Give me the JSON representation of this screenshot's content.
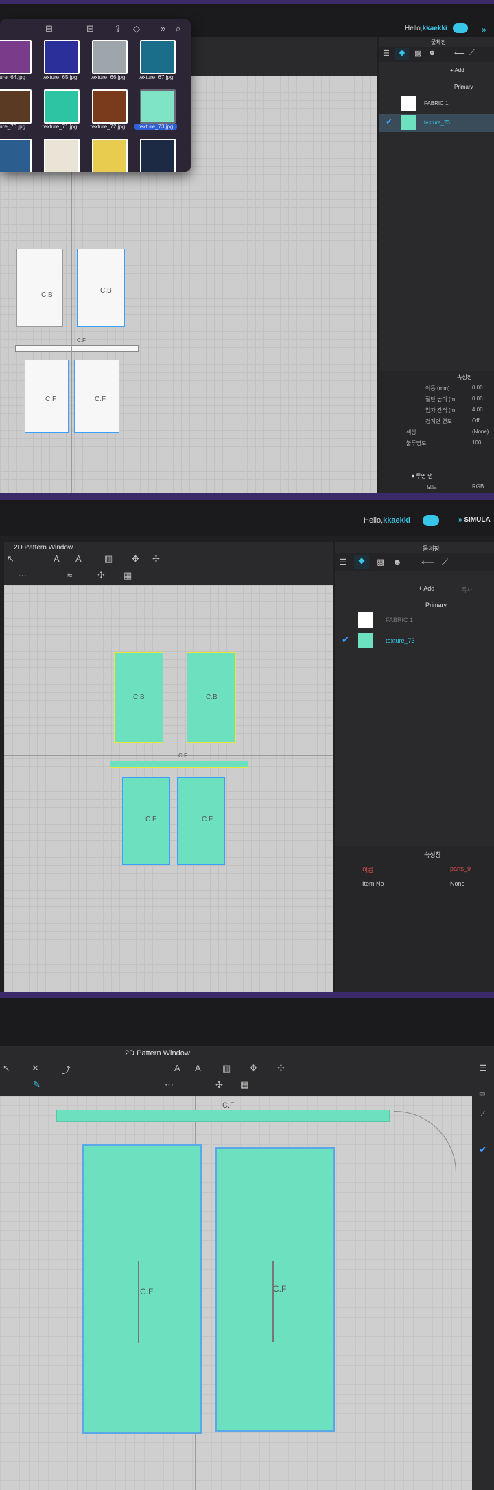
{
  "top": {
    "greeting_prefix": "Hello,",
    "username": "kkaekki",
    "simulation_label": "SIMULA"
  },
  "finder": {
    "files": [
      {
        "name": "ture_64.jpg",
        "color": "#7a3b8a"
      },
      {
        "name": "texture_65.jpg",
        "color": "#2a2f9a"
      },
      {
        "name": "texture_66.jpg",
        "color": "#9ea6ab"
      },
      {
        "name": "texture_67.jpg",
        "color": "#1b6e8a"
      },
      {
        "name": "ture_70.jpg",
        "color": "#5a3a22"
      },
      {
        "name": "texture_71.jpg",
        "color": "#2dc4a4"
      },
      {
        "name": "texture_72.jpg",
        "color": "#7a3a1c"
      },
      {
        "name": "texture_73.jpg",
        "color": "#7fe3c5"
      },
      {
        "name": "ture_76.jpg",
        "color": "#2b5d8e"
      },
      {
        "name": "texture_77.jpg",
        "color": "#e9e4d6"
      },
      {
        "name": "texture_78.jpg",
        "color": "#e8cc50"
      },
      {
        "name": "texture_79.jpg",
        "color": "#1d2a44"
      }
    ],
    "selected_file": "texture_73.jpg"
  },
  "pattern_window": {
    "title": "2D Pattern Window",
    "piece_labels": {
      "back": "C.B",
      "front": "C.F",
      "waistband": "C.F"
    }
  },
  "object_browser": {
    "title": "물체창",
    "add_label": "+ Add",
    "copy_label": "복사",
    "primary_label": "Primary",
    "fabrics": [
      {
        "name": "FABRIC 1",
        "color": "#ffffff"
      },
      {
        "name": "texture_73",
        "color": "#6de0c0"
      }
    ],
    "selected_fabric": "texture_73"
  },
  "property_editor": {
    "title": "속성창",
    "rows_screen1": [
      {
        "label": "이동 (mm)",
        "value": "0.00"
      },
      {
        "label": "절단 높이 (m",
        "value": "0.00"
      },
      {
        "label": "입자 간격 (m",
        "value": "4.00"
      },
      {
        "label": "경계면 연도",
        "value": "Off"
      },
      {
        "label": "색상",
        "value": "(None)"
      },
      {
        "label": "불투명도",
        "value": "100"
      }
    ],
    "transparency_mode_label": "▾ 투명 맵",
    "mode_label": "모드",
    "mode_value": "RGB",
    "rows_screen2": [
      {
        "label": "이름",
        "value": "parts_9"
      },
      {
        "label": "Item No",
        "value": "None"
      }
    ]
  },
  "colors": {
    "fabric_teal": "#6de0c0",
    "selection_blue": "#3aa0ff",
    "edge_yellow": "#e6e63a",
    "accent_cyan": "#38c6e8",
    "name_red": "#e05050"
  }
}
